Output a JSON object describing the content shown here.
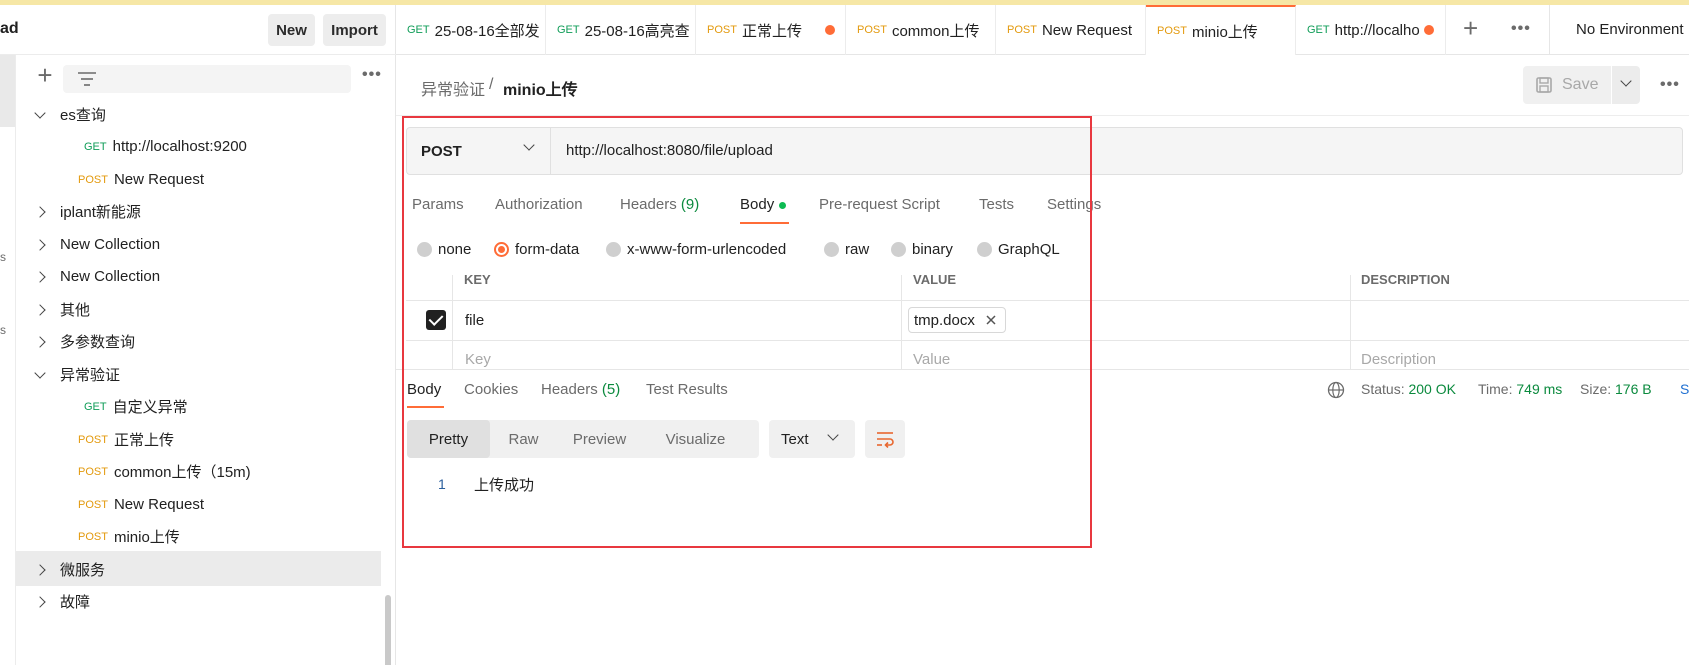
{
  "colors": {
    "accent": "#ff6c37",
    "get": "#0f9d58",
    "post": "#e39a0e",
    "ok": "#0b8a3e",
    "highlight": "#e8383f"
  },
  "sidebar": {
    "workspace_name": "ad",
    "new_label": "New",
    "import_label": "Import",
    "rail_labels": [
      "s",
      "s"
    ],
    "items": [
      {
        "type": "folder",
        "open": true,
        "label": "es查询"
      },
      {
        "type": "request",
        "method": "GET",
        "label": "http://localhost:9200"
      },
      {
        "type": "request",
        "method": "POST",
        "label": "New Request"
      },
      {
        "type": "folder",
        "open": false,
        "label": "iplant新能源"
      },
      {
        "type": "folder",
        "open": false,
        "label": "New Collection"
      },
      {
        "type": "folder",
        "open": false,
        "label": "New Collection"
      },
      {
        "type": "folder",
        "open": false,
        "label": "其他"
      },
      {
        "type": "folder",
        "open": false,
        "label": "多参数查询"
      },
      {
        "type": "folder",
        "open": true,
        "label": "异常验证"
      },
      {
        "type": "request",
        "method": "GET",
        "label": "自定义异常"
      },
      {
        "type": "request",
        "method": "POST",
        "label": "正常上传"
      },
      {
        "type": "request",
        "method": "POST",
        "label": "common上传（15m)"
      },
      {
        "type": "request",
        "method": "POST",
        "label": "New Request"
      },
      {
        "type": "request",
        "method": "POST",
        "label": "minio上传"
      },
      {
        "type": "folder",
        "open": false,
        "label": "微服务"
      },
      {
        "type": "folder",
        "open": false,
        "label": "故障"
      }
    ]
  },
  "tabs": [
    {
      "method": "GET",
      "label": "25-08-16全部发"
    },
    {
      "method": "GET",
      "label": "25-08-16高亮查"
    },
    {
      "method": "POST",
      "label": "正常上传",
      "unsaved": true
    },
    {
      "method": "POST",
      "label": "common上传"
    },
    {
      "method": "POST",
      "label": "New Request"
    },
    {
      "method": "POST",
      "label": "minio上传",
      "active": true
    },
    {
      "method": "GET",
      "label": "http://localhos",
      "unsaved": true
    }
  ],
  "environment": "No Environment",
  "breadcrumb": {
    "parent": "异常验证",
    "separator": "/",
    "current": "minio上传"
  },
  "save_label": "Save",
  "request": {
    "method": "POST",
    "url": "http://localhost:8080/file/upload",
    "tabs": [
      "Params",
      "Authorization",
      "Headers",
      "(9)",
      "Body",
      "Pre-request Script",
      "Tests",
      "Settings"
    ],
    "body_types": [
      "none",
      "form-data",
      "x-www-form-urlencoded",
      "raw",
      "binary",
      "GraphQL"
    ],
    "selected_body_type": "form-data",
    "table": {
      "headers": [
        "KEY",
        "VALUE",
        "DESCRIPTION"
      ],
      "row": {
        "checked": true,
        "key": "file",
        "value": "tmp.docx"
      },
      "placeholders": {
        "key": "Key",
        "value": "Value",
        "description": "Description"
      }
    }
  },
  "response": {
    "tabs": [
      "Body",
      "Cookies",
      "Headers",
      "(5)",
      "Test Results"
    ],
    "status_label": "Status:",
    "status": "200 OK",
    "time_label": "Time:",
    "time": "749 ms",
    "size_label": "Size:",
    "size": "176 B",
    "save_trunc": "S",
    "views": [
      "Pretty",
      "Raw",
      "Preview",
      "Visualize"
    ],
    "format": "Text",
    "line_number": "1",
    "body": "上传成功"
  }
}
